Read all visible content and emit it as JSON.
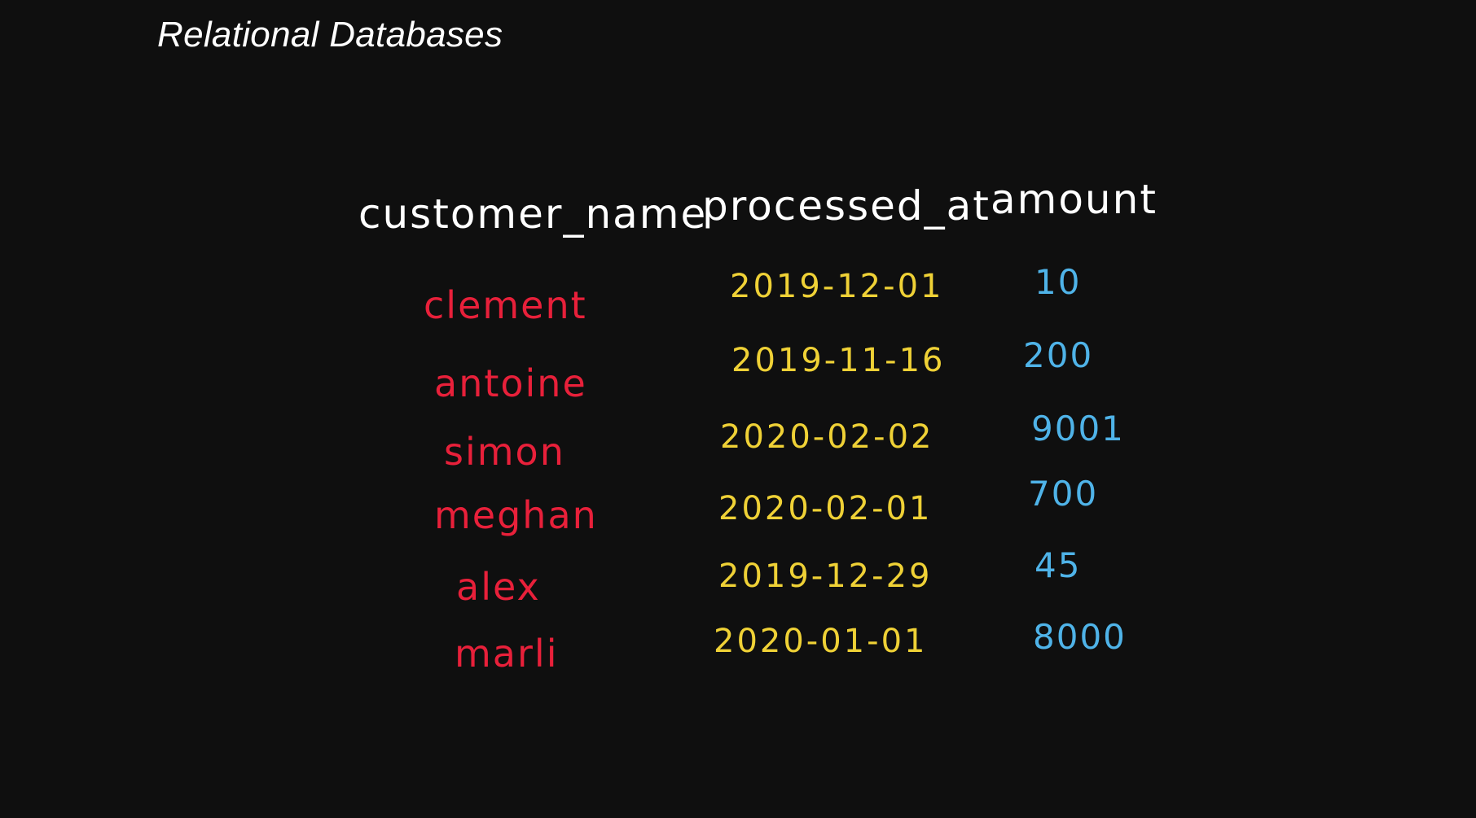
{
  "title": "Relational Databases",
  "table": {
    "headers": [
      "customer_name",
      "processed_at",
      "amount"
    ],
    "rows": [
      {
        "customer_name": "clement",
        "processed_at": "2019-12-01",
        "amount": "10"
      },
      {
        "customer_name": "antoine",
        "processed_at": "2019-11-16",
        "amount": "200"
      },
      {
        "customer_name": "simon",
        "processed_at": "2020-02-02",
        "amount": "9001"
      },
      {
        "customer_name": "meghan",
        "processed_at": "2020-02-01",
        "amount": "700"
      },
      {
        "customer_name": "alex",
        "processed_at": "2019-12-29",
        "amount": "45"
      },
      {
        "customer_name": "marli",
        "processed_at": "2020-01-01",
        "amount": "8000"
      }
    ]
  },
  "colors": {
    "background": "#0f0f0f",
    "header": "#ffffff",
    "customer_name": "#e8203a",
    "processed_at": "#efd136",
    "amount": "#4fb3e8"
  }
}
